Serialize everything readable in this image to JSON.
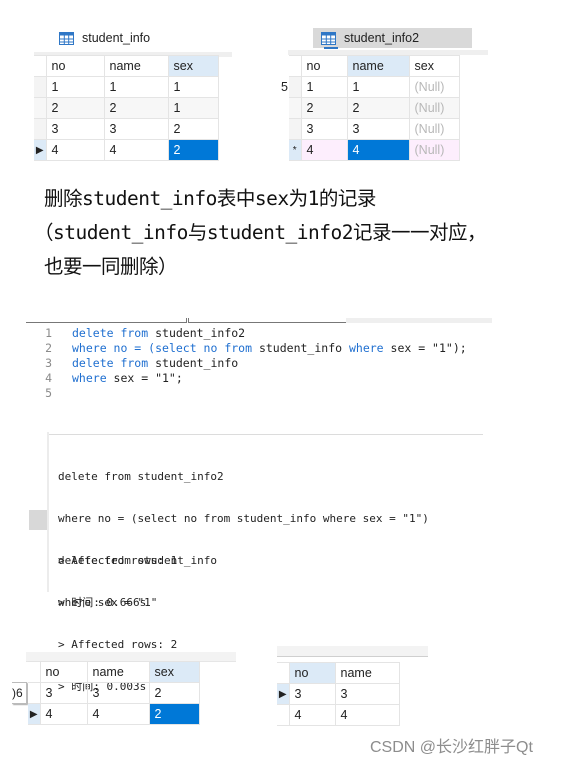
{
  "table1": {
    "title": "student_info",
    "icon": "table-grid-icon",
    "columns": [
      "no",
      "name",
      "sex"
    ],
    "rows": [
      [
        "1",
        "1",
        "1"
      ],
      [
        "2",
        "2",
        "1"
      ],
      [
        "3",
        "3",
        "2"
      ],
      [
        "4",
        "4",
        "2"
      ]
    ],
    "current_row_marker": "▶"
  },
  "table2": {
    "title": "student_info2",
    "icon": "table-grid-icon",
    "columns": [
      "no",
      "name",
      "sex"
    ],
    "rows": [
      [
        "1",
        "1",
        "(Null)"
      ],
      [
        "2",
        "2",
        "(Null)"
      ],
      [
        "3",
        "3",
        "(Null)"
      ],
      [
        "4",
        "4",
        "(Null)"
      ]
    ],
    "side_fragment": "5",
    "new_row_marker": "*"
  },
  "heading": {
    "line1": "删除student_info表中sex为1的记录",
    "line2": "（student_info与student_info2记录一一对应，",
    "line3": "也要一同删除）"
  },
  "editor": {
    "lines": [
      {
        "num": "1",
        "tokens": [
          {
            "t": "delete from",
            "k": true
          },
          {
            "t": " student_info2",
            "k": false
          }
        ]
      },
      {
        "num": "2",
        "tokens": [
          {
            "t": "where no = (",
            "k": true
          },
          {
            "t": "select no from",
            "k": true
          },
          {
            "t": " student_info ",
            "k": false
          },
          {
            "t": "where",
            "k": true
          },
          {
            "t": " sex = \"1\");",
            "k": false
          }
        ]
      },
      {
        "num": "3",
        "tokens": [
          {
            "t": "delete from",
            "k": true
          },
          {
            "t": " student_info",
            "k": false
          }
        ]
      },
      {
        "num": "4",
        "tokens": [
          {
            "t": "where",
            "k": true
          },
          {
            "t": " sex = \"1\";",
            "k": false
          }
        ]
      },
      {
        "num": "5",
        "tokens": []
      }
    ]
  },
  "output": {
    "block1": {
      "line1": "delete from student_info2",
      "line2": "where no = (select no from student_info where sex = \"1\")",
      "line3": "> Affected rows: 1",
      "line4": "> 时间: 0.666s"
    },
    "block2": {
      "line1": "delete from student_info",
      "line2": "where sex = \"1\"",
      "line3": "> Affected rows: 2",
      "line4": "> 时间: 0.003s"
    }
  },
  "result1": {
    "columns": [
      "no",
      "name",
      "sex"
    ],
    "rows": [
      [
        "3",
        "3",
        "2"
      ],
      [
        "4",
        "4",
        "2"
      ]
    ],
    "side_fragment": ")6",
    "current_row_marker": "▶"
  },
  "result2": {
    "columns": [
      "no",
      "name"
    ],
    "rows": [
      [
        "3",
        "3"
      ],
      [
        "4",
        "4"
      ]
    ],
    "current_row_marker": "▶"
  },
  "watermark": "CSDN @长沙红胖子Qt",
  "colors": {
    "selection": "#0078d7",
    "header_selected": "#dceaf7",
    "keyword": "#1f6fd0",
    "null_text": "#b8b8b8",
    "new_row": "#fdeefd"
  }
}
